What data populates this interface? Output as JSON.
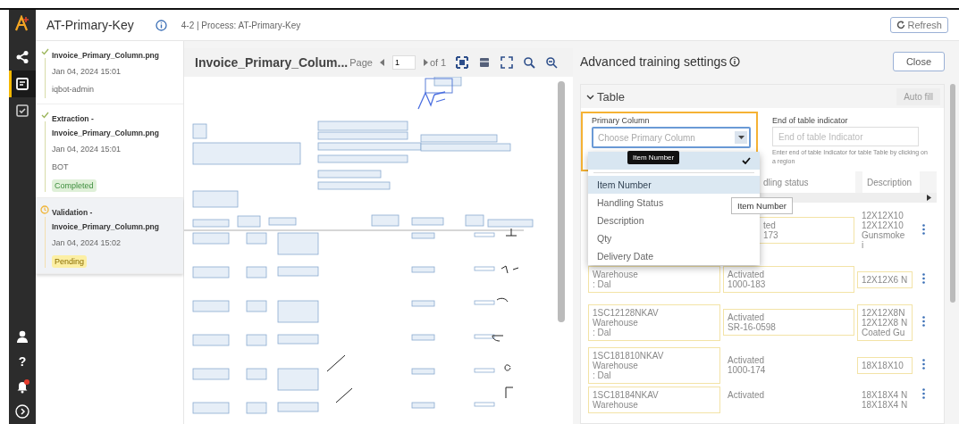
{
  "rail": {
    "items": [
      {
        "kind": "share",
        "selected": false
      },
      {
        "kind": "document",
        "selected": true
      },
      {
        "kind": "checklist",
        "selected": false
      }
    ],
    "bottom": [
      {
        "kind": "user"
      },
      {
        "kind": "help",
        "glyph": "?"
      },
      {
        "kind": "bell",
        "has_notification": true
      },
      {
        "kind": "expand"
      }
    ]
  },
  "header": {
    "title": "AT-Primary-Key",
    "subtitle": "4-2 | Process: AT-Primary-Key",
    "refresh": "Refresh"
  },
  "activity": [
    {
      "title": "Invoice_Primary_Column.png",
      "date": "Jan 04, 2024 15:01",
      "user": "iqbot-admin",
      "kind": "done",
      "selected": false
    },
    {
      "title": "Extraction - Invoice_Primary_Column.png",
      "date": "Jan 04, 2024 15:01",
      "user": "BOT",
      "kind": "done",
      "badge": {
        "label": "Completed",
        "kind": "success"
      },
      "selected": false
    },
    {
      "title": "Validation - Invoice_Primary_Column.png",
      "date": "Jan 04, 2024 15:02",
      "kind": "pending",
      "badge": {
        "label": "Pending",
        "kind": "warning"
      },
      "selected": true
    }
  ],
  "viewer": {
    "file_name": "Invoice_Primary_Colum...",
    "page_label": "Page",
    "page": "1",
    "page_total": "of 1"
  },
  "settings": {
    "title": "Advanced training settings",
    "close": "Close",
    "section": {
      "title": "Table",
      "expanded": true,
      "auto_fill": "Auto fill",
      "primary_column": {
        "label": "Primary Column",
        "placeholder": "Choose Primary Column",
        "highlighted": true
      },
      "end_indicator": {
        "label": "End of table indicator",
        "placeholder": "End of table Indicator",
        "help": "Enter end of table Indicator for table Table by clicking on a region"
      },
      "dropdown": {
        "open": true,
        "tooltip": "Item Number",
        "options": [
          {
            "label": "Item Number",
            "selected": true
          },
          {
            "label": "Handling Status",
            "selected": false
          },
          {
            "label": "Description",
            "selected": false
          },
          {
            "label": "Qty",
            "selected": false
          },
          {
            "label": "Delivery Date",
            "selected": false
          }
        ]
      },
      "column_tooltip": "Item Number",
      "columns": [
        "",
        "dling status",
        "Description"
      ],
      "rows": [
        {
          "cells": [
            {
              "boxed": false
            },
            {
              "lines": [
                "ted",
                "173"
              ],
              "boxed": true
            },
            {
              "lines": [
                "12X12X10",
                "12X12X10",
                "Gunsmoke",
                "i"
              ],
              "boxed": false
            }
          ]
        },
        {
          "cells": [
            {
              "lines": [
                "Warehouse",
                ": Dal"
              ],
              "boxed": true
            },
            {
              "lines": [
                "Activated",
                "1000-183"
              ],
              "boxed": true
            },
            {
              "lines": [
                "12X12X6 N"
              ],
              "boxed": true
            }
          ]
        },
        {
          "cells": [
            {
              "lines": [
                "1SC12128NKAV",
                "Warehouse",
                ": Dal"
              ],
              "boxed": true
            },
            {
              "lines": [
                "Activated",
                "SR-16-0598"
              ],
              "boxed": true
            },
            {
              "lines": [
                "12X12X8N",
                "12X12X8 N",
                "Coated Gu"
              ],
              "boxed": true
            }
          ]
        },
        {
          "cells": [
            {
              "lines": [
                "1SC181810NKAV",
                "Warehouse",
                ": Dal"
              ],
              "boxed": true
            },
            {
              "lines": [
                "Activated",
                "1000-174"
              ],
              "boxed": false
            },
            {
              "lines": [
                "18X18X10"
              ],
              "boxed": true
            }
          ]
        },
        {
          "cells": [
            {
              "lines": [
                "1SC18184NKAV",
                "Warehouse"
              ],
              "boxed": true
            },
            {
              "lines": [
                "Activated"
              ],
              "boxed": false
            },
            {
              "lines": [
                "18X18X4 N",
                "18X18X4 N"
              ],
              "boxed": false
            }
          ]
        }
      ]
    }
  }
}
